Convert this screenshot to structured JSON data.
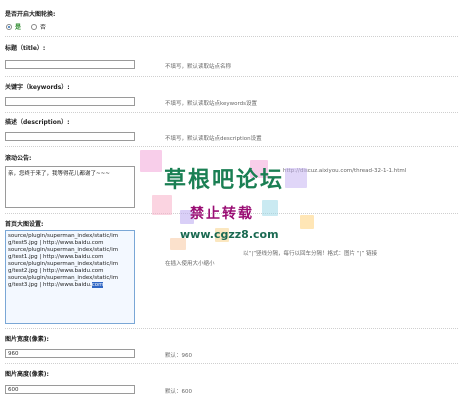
{
  "settings": {
    "enable_player": {
      "label": "是否开启大图轮换:",
      "options": [
        {
          "label": "是",
          "checked": true
        },
        {
          "label": "否",
          "checked": false
        }
      ]
    },
    "title": {
      "label": "标题（title）:",
      "value": "",
      "hint": "不填写，默认读取站点名称"
    },
    "keywords": {
      "label": "关键字（keywords）:",
      "value": "",
      "hint": "不填写，默认读取站点keywords设置"
    },
    "description": {
      "label": "描述（description）:",
      "value": "",
      "hint": "不填写，默认读取站点description设置"
    },
    "notice": {
      "label": "滚动公告:",
      "value": "亲，您终于来了，我等得花儿都谢了~~~",
      "hint_tail": "http://discuz.aixiyou.com/thread-32-1-1.html"
    },
    "slides": {
      "label": "首页大图设置:",
      "lines": [
        "source/plugin/superman_index/static/im",
        "g/test5.jpg | http://www.baidu.com",
        "source/plugin/superman_index/static/im",
        "g/test1.jpg | http://www.baidu.com",
        "source/plugin/superman_index/static/im",
        "g/test2.jpg | http://www.baidu.com",
        "source/plugin/superman_index/static/im",
        "g/test3.jpg | http://www.baidu."
      ],
      "selected_tail": "com",
      "hint_line1": "以“|”竖线分隔，每行以回车分隔！格式：图片 “|” 链接",
      "hint_line2": "在插入使用大小缩小"
    },
    "width": {
      "label": "图片宽度(像素):",
      "value": "960",
      "hint": "默认：960"
    },
    "height": {
      "label": "图片高度(像素):",
      "value": "600",
      "hint": "默认：600"
    }
  },
  "watermark": {
    "title": "草根吧论坛",
    "subtitle": "禁止转载",
    "url": "www.cgzz8.com"
  }
}
